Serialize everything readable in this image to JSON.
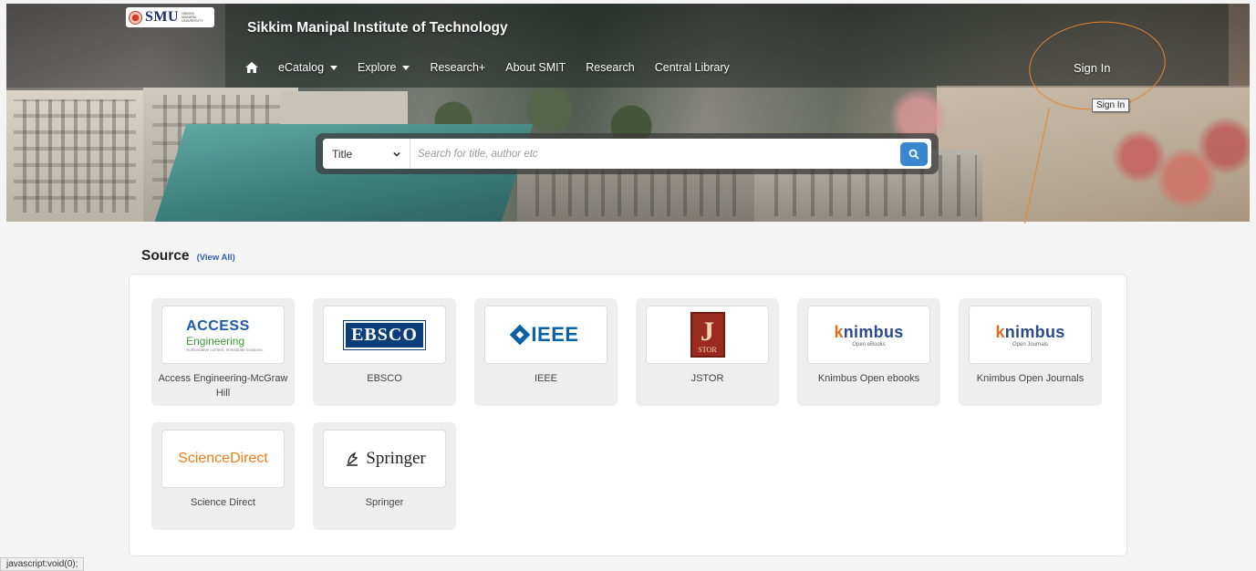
{
  "header": {
    "logo_text": "SMU",
    "logo_subtext": "SIKKIM MANIPAL UNIVERSITY",
    "site_title": "Sikkim Manipal Institute of Technology",
    "menu": [
      {
        "label": "eCatalog",
        "dropdown": true
      },
      {
        "label": "Explore",
        "dropdown": true
      },
      {
        "label": "Research+",
        "dropdown": false
      },
      {
        "label": "About SMIT",
        "dropdown": false
      },
      {
        "label": "Research",
        "dropdown": false
      },
      {
        "label": "Central Library",
        "dropdown": false
      }
    ],
    "sign_in_label": "Sign In",
    "tooltip": "Sign In"
  },
  "search": {
    "field_selected": "Title",
    "placeholder": "Search for title, author etc"
  },
  "source": {
    "heading": "Source",
    "view_all": "(View All)",
    "items": [
      {
        "label": "Access Engineering-McGraw Hill",
        "logo": {
          "line1": "ACCESS",
          "line2": "Engineering",
          "line3": "Authoritative content. Immediate solutions."
        }
      },
      {
        "label": "EBSCO",
        "logo": {
          "text": "EBSCO"
        }
      },
      {
        "label": "IEEE",
        "logo": {
          "text": "IEEE"
        }
      },
      {
        "label": "JSTOR",
        "logo": {
          "letter": "J",
          "text": "STOR"
        }
      },
      {
        "label": "Knimbus Open ebooks",
        "logo": {
          "text": "knimbus",
          "sub": "Open eBooks"
        }
      },
      {
        "label": "Knimbus Open Journals",
        "logo": {
          "text": "knimbus",
          "sub": "Open Journals"
        }
      },
      {
        "label": "Science Direct",
        "logo": {
          "text": "ScienceDirect"
        }
      },
      {
        "label": "Springer",
        "logo": {
          "text": "Springer"
        }
      }
    ]
  },
  "status_bar": "javascript:void(0);",
  "colors": {
    "accent": "#3a87cf",
    "link": "#2f5fb5",
    "annotation": "#e8842a"
  }
}
